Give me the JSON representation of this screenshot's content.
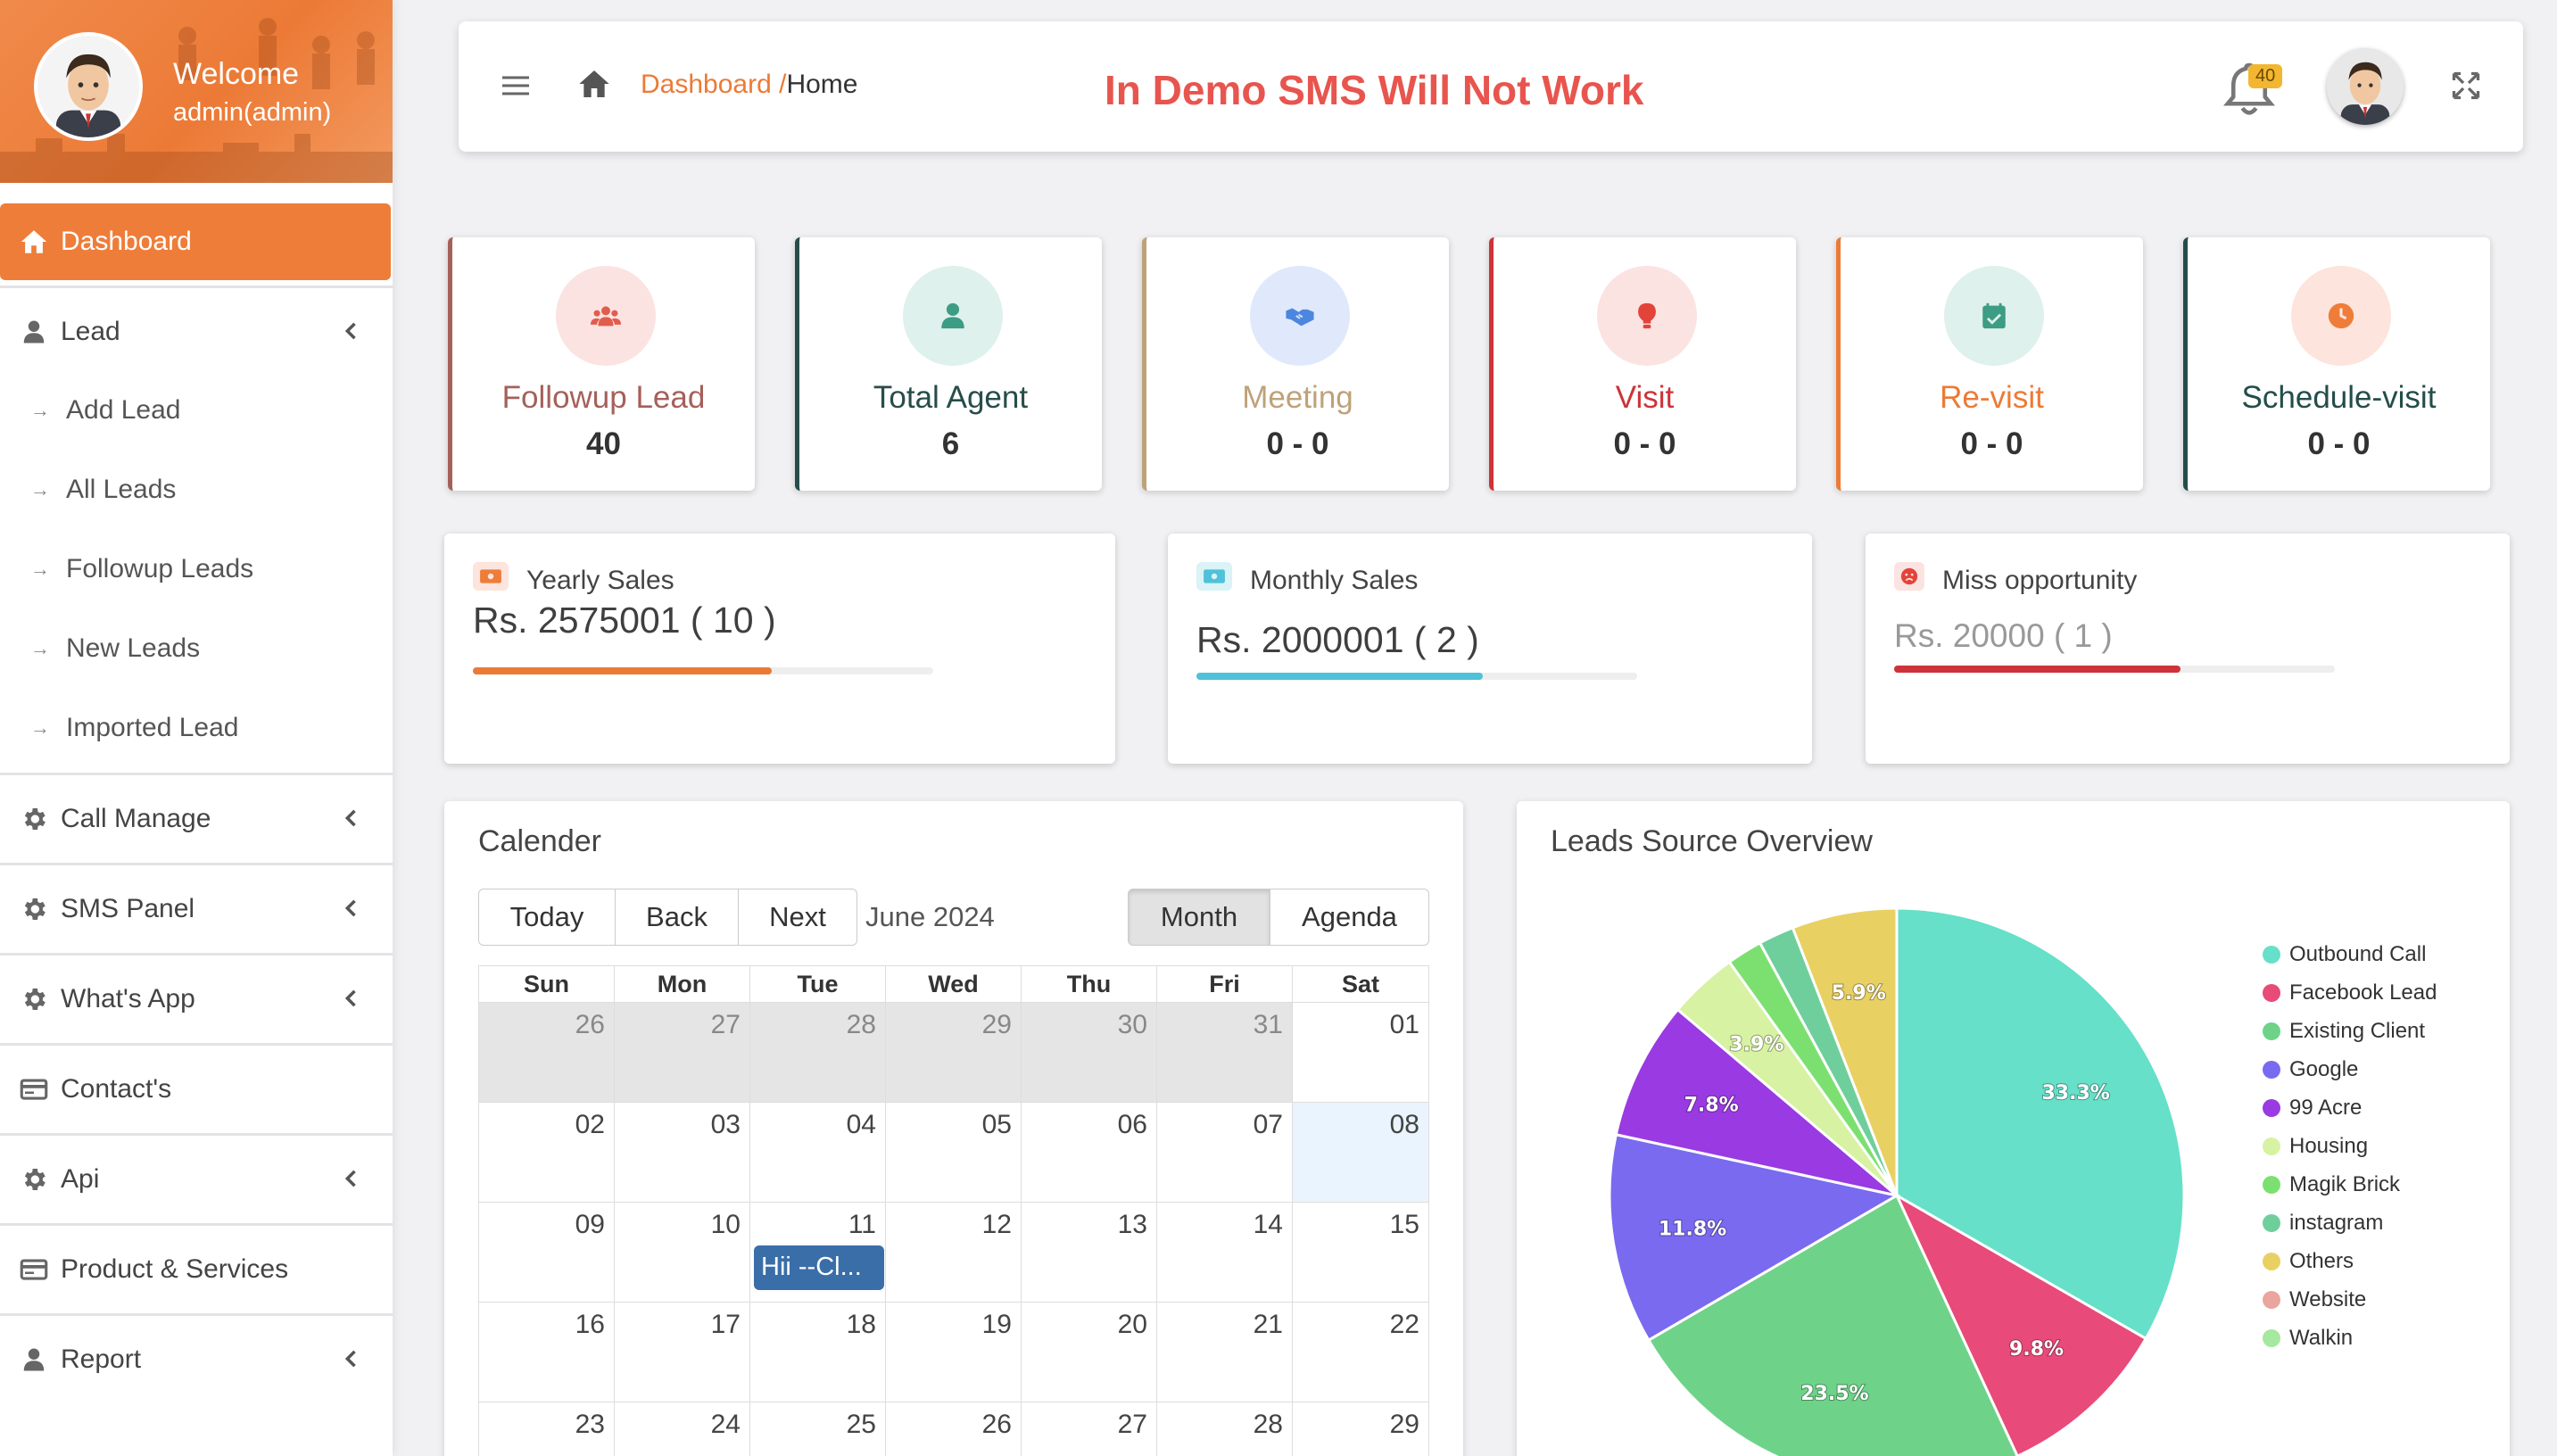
{
  "sidebar": {
    "welcome": "Welcome",
    "user": "admin(admin)",
    "menu": [
      {
        "label": "Dashboard"
      },
      {
        "label": "Lead"
      },
      {
        "label": "Call Manage"
      },
      {
        "label": "SMS Panel"
      },
      {
        "label": "What's App"
      },
      {
        "label": "Contact's"
      },
      {
        "label": "Api"
      },
      {
        "label": "Product & Services"
      },
      {
        "label": "Report"
      }
    ],
    "lead_sub": [
      "Add Lead",
      "All Leads",
      "Followup Leads",
      "New Leads",
      "Imported Lead"
    ]
  },
  "header": {
    "crumb_dashboard": "Dashboard /",
    "crumb_home": "Home",
    "demo_notice": "In Demo SMS Will Not Work",
    "notifications": "40"
  },
  "stats": [
    {
      "label": "Followup Lead",
      "value": "40",
      "color": "#a5605a",
      "circle": "#fbe3e1",
      "icon_color": "#e25c4d"
    },
    {
      "label": "Total Agent",
      "value": "6",
      "color": "#274d4a",
      "circle": "#def1ec",
      "icon_color": "#3d9c84"
    },
    {
      "label": "Meeting",
      "value": "0 - 0",
      "color": "#bea27a",
      "circle": "#dfe9fb",
      "icon_color": "#4d86de"
    },
    {
      "label": "Visit",
      "value": "0 - 0",
      "color": "#cd3338",
      "circle": "#fbe3e1",
      "icon_color": "#e2443a"
    },
    {
      "label": "Re-visit",
      "value": "0 - 0",
      "color": "#ec7a36",
      "circle": "#def1ec",
      "icon_color": "#3d9c84"
    },
    {
      "label": "Schedule-visit",
      "value": "0 - 0",
      "color": "#234d4a",
      "circle": "#fde4dc",
      "icon_color": "#ee7d3a"
    }
  ],
  "sales": [
    {
      "title": "Yearly Sales",
      "amount": "Rs. 2575001 ( 10 )",
      "progress": 0.65,
      "color": "#ec7a36"
    },
    {
      "title": "Monthly Sales",
      "amount": "Rs. 2000001 ( 2 )",
      "progress": 0.65,
      "color": "#4fc1d8"
    },
    {
      "title": "Miss opportunity",
      "amount": "Rs. 20000 ( 1 )",
      "progress": 0.65,
      "color": "#cd3338"
    }
  ],
  "calendar": {
    "title": "Calender",
    "buttons": [
      "Today",
      "Back",
      "Next"
    ],
    "views": [
      "Month",
      "Agenda"
    ],
    "month_label": "June 2024",
    "days": [
      "Sun",
      "Mon",
      "Tue",
      "Wed",
      "Thu",
      "Fri",
      "Sat"
    ],
    "weeks": [
      [
        "26",
        "27",
        "28",
        "29",
        "30",
        "31",
        "01"
      ],
      [
        "02",
        "03",
        "04",
        "05",
        "06",
        "07",
        "08"
      ],
      [
        "09",
        "10",
        "11",
        "12",
        "13",
        "14",
        "15"
      ],
      [
        "16",
        "17",
        "18",
        "19",
        "20",
        "21",
        "22"
      ],
      [
        "23",
        "24",
        "25",
        "26",
        "27",
        "28",
        "29"
      ]
    ],
    "event": "Hii --Cl..."
  },
  "leads_source": {
    "title": "Leads Source Overview"
  },
  "chart_data": {
    "type": "pie",
    "title": "Leads Source Overview",
    "series": [
      {
        "name": "Outbound Call",
        "value": 33.3,
        "label": "33.3%",
        "color": "#66e0c8"
      },
      {
        "name": "Facebook Lead",
        "value": 9.8,
        "label": "9.8%",
        "color": "#e84a79"
      },
      {
        "name": "Existing Client",
        "value": 23.5,
        "label": "23.5%",
        "color": "#6ed389"
      },
      {
        "name": "Google",
        "value": 11.8,
        "label": "11.8%",
        "color": "#7a6af0"
      },
      {
        "name": "99 Acre",
        "value": 7.8,
        "label": "7.8%",
        "color": "#9a3ae2"
      },
      {
        "name": "Housing",
        "value": 3.9,
        "label": "3.9%",
        "color": "#d7f2a2"
      },
      {
        "name": "Magik Brick",
        "value": 2.0,
        "label": "",
        "color": "#7ce070"
      },
      {
        "name": "instagram",
        "value": 2.0,
        "label": "",
        "color": "#6fcf9c"
      },
      {
        "name": "Others",
        "value": 5.9,
        "label": "5.9%",
        "color": "#e8d063"
      },
      {
        "name": "Website",
        "value": 0,
        "label": "",
        "color": "#eaa59e"
      },
      {
        "name": "Walkin",
        "value": 0,
        "label": "",
        "color": "#a5e8a0"
      }
    ],
    "legend": "right"
  }
}
